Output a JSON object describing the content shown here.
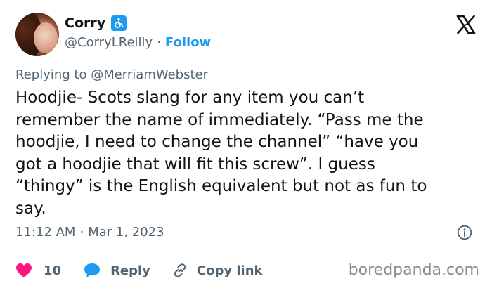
{
  "author": {
    "name": "Corry",
    "handle": "@CorryLReilly",
    "separator": "·",
    "follow_label": "Follow"
  },
  "reply_to": "Replying to @MerriamWebster",
  "tweet_text": "Hoodjie- Scots slang for any item you can’t\nremember the name of immediately. “Pass me the\nhoodjie, I need to change the channel” “have you\ngot a hoodjie that will fit this screw”. I guess\n“thingy” is the English equivalent but not as fun to\nsay.",
  "timestamp": {
    "time": "11:12 AM",
    "separator": "·",
    "date": "Mar 1, 2023"
  },
  "actions": {
    "likes_count": "10",
    "reply_label": "Reply",
    "copy_link_label": "Copy link"
  },
  "watermark": "boredpanda.com",
  "icons": {
    "badge": "wheelchair-icon",
    "logo": "x-logo-icon",
    "info": "info-icon",
    "like": "heart-icon",
    "reply": "speech-bubble-icon",
    "copy": "link-icon"
  },
  "colors": {
    "accent": "#1d9bf0",
    "like": "#f91880",
    "text": "#0f1419",
    "muted": "#536471"
  }
}
